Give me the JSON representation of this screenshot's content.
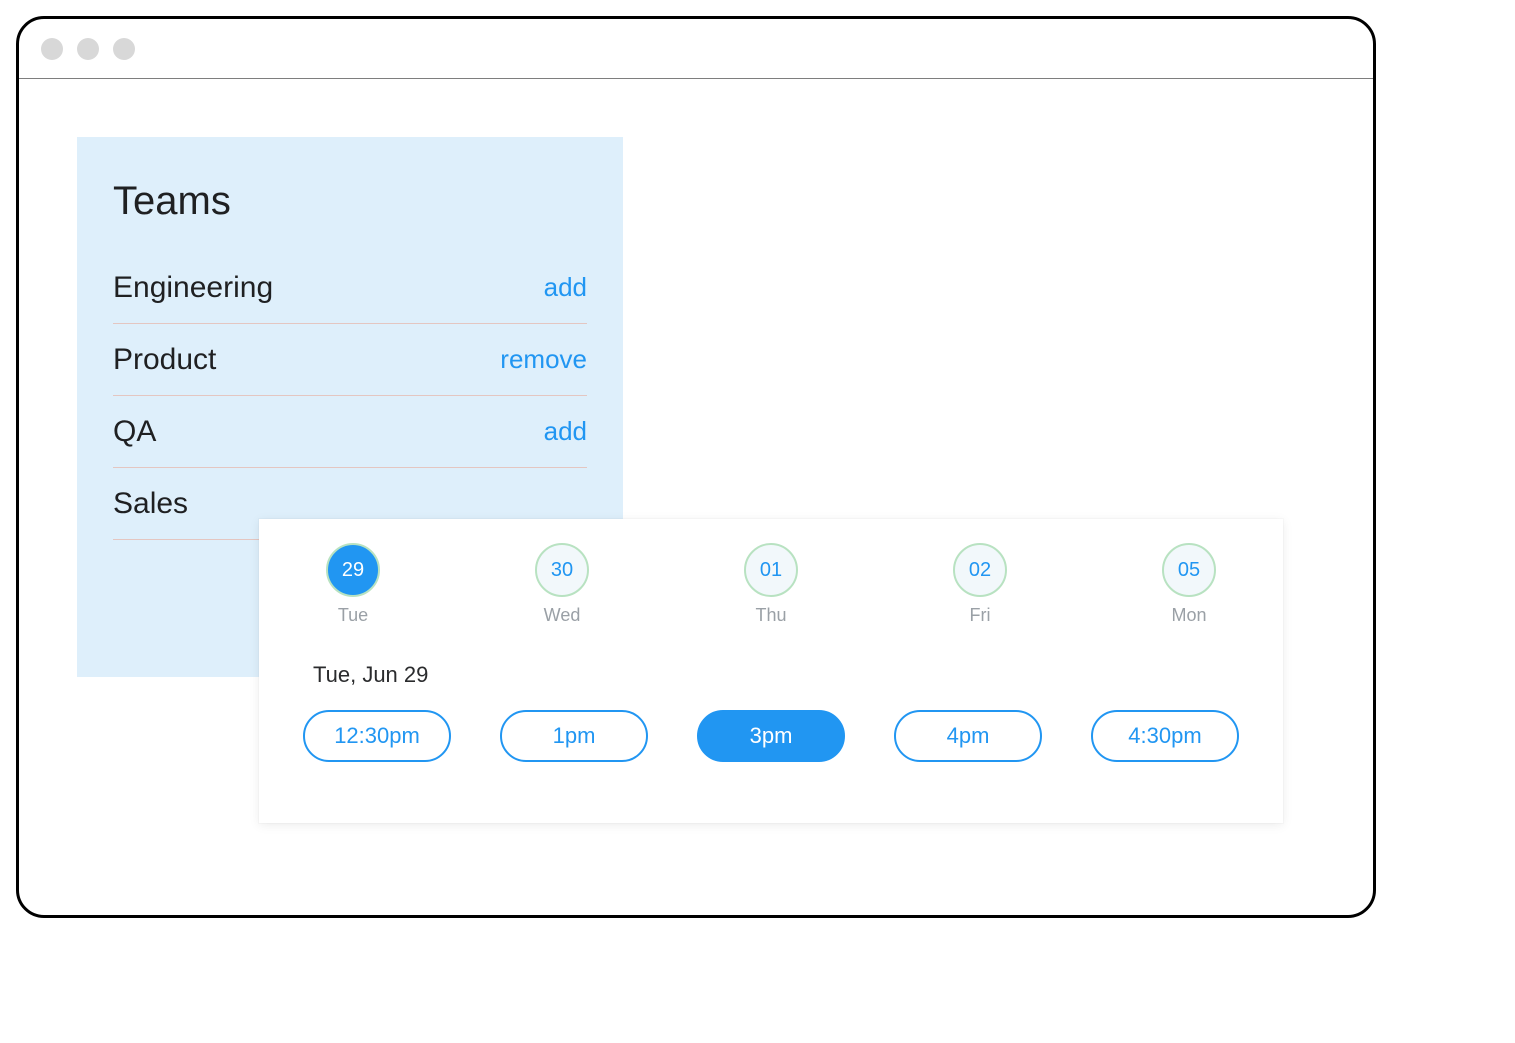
{
  "teams": {
    "title": "Teams",
    "items": [
      {
        "name": "Engineering",
        "action": "add"
      },
      {
        "name": "Product",
        "action": "remove"
      },
      {
        "name": "QA",
        "action": "add"
      },
      {
        "name": "Sales",
        "action": ""
      }
    ]
  },
  "picker": {
    "days": [
      {
        "num": "29",
        "dow": "Tue",
        "selected": true
      },
      {
        "num": "30",
        "dow": "Wed",
        "selected": false
      },
      {
        "num": "01",
        "dow": "Thu",
        "selected": false
      },
      {
        "num": "02",
        "dow": "Fri",
        "selected": false
      },
      {
        "num": "05",
        "dow": "Mon",
        "selected": false
      }
    ],
    "selected_date_label": "Tue, Jun 29",
    "times": [
      {
        "label": "12:30pm",
        "selected": false
      },
      {
        "label": "1pm",
        "selected": false
      },
      {
        "label": "3pm",
        "selected": true
      },
      {
        "label": "4pm",
        "selected": false
      },
      {
        "label": "4:30pm",
        "selected": false
      }
    ]
  }
}
